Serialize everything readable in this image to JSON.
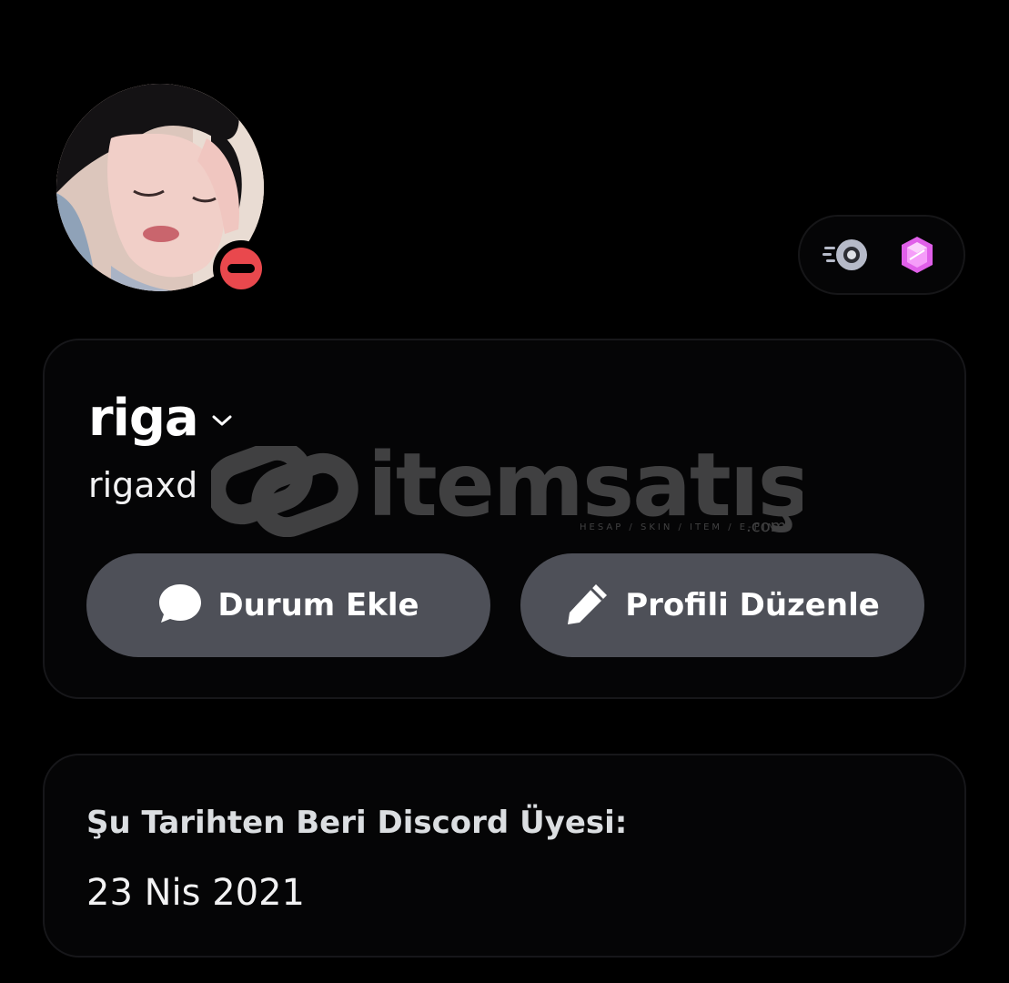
{
  "profile": {
    "display_name": "riga",
    "username": "rigaxd",
    "status": "do-not-disturb",
    "status_color": "#e9484d"
  },
  "badges": [
    {
      "icon": "nitro-speed-badge-icon"
    },
    {
      "icon": "hypesquad-gem-badge-icon",
      "color": "#e05fe9"
    }
  ],
  "actions": {
    "add_status_label": "Durum Ekle",
    "add_status_icon": "speech-bubble-icon",
    "edit_profile_label": "Profili Düzenle",
    "edit_profile_icon": "pencil-icon",
    "button_color": "#4e5058"
  },
  "member_since": {
    "label": "Şu Tarihten Beri Discord Üyesi:",
    "date": "23 Nis 2021"
  },
  "watermark": {
    "brand": "itemsatış",
    "tagline": "HESAP / SKIN / ITEM / E-PIN",
    "suffix": ".com"
  }
}
